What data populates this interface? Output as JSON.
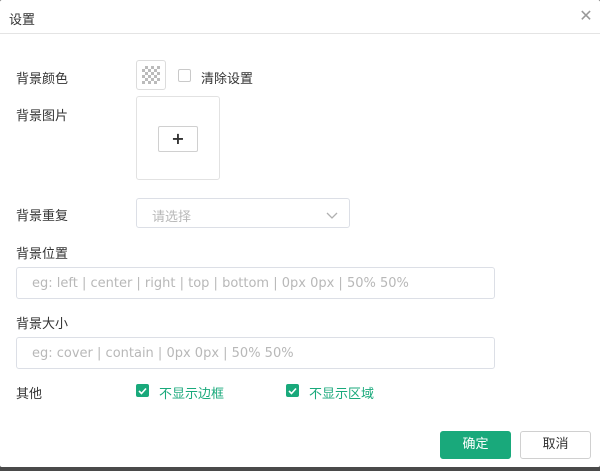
{
  "dialog": {
    "title": "设置",
    "close_icon": "close-icon"
  },
  "form": {
    "bg_color": {
      "label": "背景颜色",
      "clear_label": "清除设置",
      "clear_checked": false
    },
    "bg_image": {
      "label": "背景图片",
      "upload_symbol": "+"
    },
    "bg_repeat": {
      "label": "背景重复",
      "placeholder": "请选择"
    },
    "bg_position": {
      "label": "背景位置",
      "placeholder": "eg: left | center | right | top | bottom | 0px 0px | 50% 50%",
      "value": ""
    },
    "bg_size": {
      "label": "背景大小",
      "placeholder": "eg: cover | contain | 0px 0px | 50% 50%",
      "value": ""
    },
    "other": {
      "label": "其他",
      "options": [
        {
          "label": "不显示边框",
          "checked": true
        },
        {
          "label": "不显示区域",
          "checked": true
        }
      ]
    }
  },
  "footer": {
    "confirm_label": "确定",
    "cancel_label": "取消"
  },
  "colors": {
    "accent": "#19a97b",
    "border": "#dcdfe6",
    "placeholder": "#b8b8b8"
  }
}
